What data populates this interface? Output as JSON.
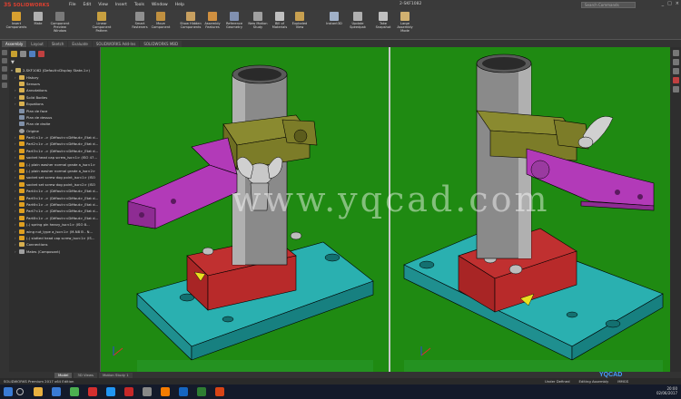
{
  "app": {
    "brand": "SOLIDWORKS",
    "document_title": "2-SKF1082",
    "search_placeholder": "Search Commands",
    "menu": [
      "File",
      "Edit",
      "View",
      "Insert",
      "Tools",
      "Window",
      "Help"
    ],
    "window_controls": [
      "_",
      "□",
      "×"
    ]
  },
  "ribbon": {
    "commands": [
      {
        "label": "Insert Components",
        "icon": "insert-components-icon",
        "color": "#d8a030"
      },
      {
        "label": "Mate",
        "icon": "mate-icon",
        "color": "#b0b0b0"
      },
      {
        "label": "Component Preview Window",
        "icon": "preview-icon",
        "color": "#7a7a7a"
      },
      {
        "label": "Linear Component Pattern",
        "icon": "pattern-icon",
        "color": "#c8a040"
      },
      {
        "label": "Smart Fasteners",
        "icon": "fastener-icon",
        "color": "#909090"
      },
      {
        "label": "Move Component",
        "icon": "move-icon",
        "color": "#c09040"
      },
      {
        "label": "Show Hidden Components",
        "icon": "show-hidden-icon",
        "color": "#c8a060"
      },
      {
        "label": "Assembly Features",
        "icon": "assembly-features-icon",
        "color": "#d09040"
      },
      {
        "label": "Reference Geometry",
        "icon": "reference-geometry-icon",
        "color": "#8090b0"
      },
      {
        "label": "New Motion Study",
        "icon": "motion-study-icon",
        "color": "#a0a0a0"
      },
      {
        "label": "Bill of Materials",
        "icon": "bom-icon",
        "color": "#c0c0c0"
      },
      {
        "label": "Exploded View",
        "icon": "exploded-view-icon",
        "color": "#c8a050"
      },
      {
        "label": "Instant3D",
        "icon": "instant3d-icon",
        "color": "#a0b0c8"
      },
      {
        "label": "Update Speedpak",
        "icon": "speedpak-icon",
        "color": "#b0b0b0"
      },
      {
        "label": "Take Snapshot",
        "icon": "snapshot-icon",
        "color": "#c0c0c0"
      },
      {
        "label": "Large Assembly Mode",
        "icon": "large-assembly-icon",
        "color": "#d0b070"
      }
    ]
  },
  "tabs": [
    "Assembly",
    "Layout",
    "Sketch",
    "Evaluate",
    "SOLIDWORKS Add-Ins",
    "SOLIDWORKS MBD"
  ],
  "feature_tree": {
    "rows": [
      {
        "label": "2-SKF1082 (Default<Display State-1>)",
        "icon": "asm",
        "arrow": "▾"
      },
      {
        "label": "History",
        "icon": "folder",
        "arrow": "›"
      },
      {
        "label": "Sensors",
        "icon": "folder",
        "arrow": ""
      },
      {
        "label": "Annotations",
        "icon": "folder",
        "arrow": "›"
      },
      {
        "label": "Solid Bodies",
        "icon": "folder",
        "arrow": "›"
      },
      {
        "label": "Equations",
        "icon": "folder",
        "arrow": "›"
      },
      {
        "label": "Plan de face",
        "icon": "plane",
        "arrow": ""
      },
      {
        "label": "Plan de dessus",
        "icon": "plane",
        "arrow": ""
      },
      {
        "label": "Plan de droite",
        "icon": "plane",
        "arrow": ""
      },
      {
        "label": "Origine",
        "icon": "origin",
        "arrow": ""
      },
      {
        "label": "Part1<1> -> (Défaut<<Défaut>_Etat d...",
        "icon": "part",
        "arrow": "›"
      },
      {
        "label": "Part2<1> -> (Défaut<<Défaut>_Etat d...",
        "icon": "part",
        "arrow": "›"
      },
      {
        "label": "Part3<1> -> (Défaut<<Défaut>_Etat d...",
        "icon": "part",
        "arrow": "›"
      },
      {
        "label": "socket head cap screw_iso<1> (ISO 47...",
        "icon": "part",
        "arrow": "›"
      },
      {
        "label": "(-) plain washer normal grade a_iso<1>",
        "icon": "part",
        "arrow": "›"
      },
      {
        "label": "(-) plain washer normal grade a_iso<2>",
        "icon": "part",
        "arrow": "›"
      },
      {
        "label": "socket set screw dog point_iso<1> (ISO",
        "icon": "part",
        "arrow": "›"
      },
      {
        "label": "socket set screw dog point_iso<2> (ISO",
        "icon": "part",
        "arrow": "›"
      },
      {
        "label": "Part4<1> -> (Défaut<<Défaut>_Etat d...",
        "icon": "part",
        "arrow": "›"
      },
      {
        "label": "Part5<1> -> (Défaut<<Défaut>_Etat d...",
        "icon": "part",
        "arrow": "›"
      },
      {
        "label": "Part6<1> -> (Défaut<<Défaut>_Etat d...",
        "icon": "part",
        "arrow": "›"
      },
      {
        "label": "Part7<1> -> (Défaut<<Défaut>_Etat d...",
        "icon": "part",
        "arrow": "›"
      },
      {
        "label": "Part8<1> -> (Défaut<<Défaut>_Etat d...",
        "icon": "part",
        "arrow": "›"
      },
      {
        "label": "(-) spring pin heavy_iso<1> (ISO 8...",
        "icon": "part",
        "arrow": "›"
      },
      {
        "label": "wing nut_type a_iso<1> (M-N8 B - N...",
        "icon": "part",
        "arrow": "›"
      },
      {
        "label": "(-) slotted head cap screw_iso<1> (IS...",
        "icon": "part",
        "arrow": "›"
      },
      {
        "label": "Connections",
        "icon": "folder",
        "arrow": "›"
      },
      {
        "label": "Mates (Composant)",
        "icon": "mate",
        "arrow": "›"
      }
    ]
  },
  "viewport": {
    "background": "#1f8a12",
    "watermark": "www.yqcad.com"
  },
  "bottom_tabs": [
    "Model",
    "3D Views",
    "Motion Study 1"
  ],
  "status": {
    "left": "SOLIDWORKS Premium 2017 x64 Edition",
    "state": "Under Defined",
    "mode": "Editing Assembly",
    "units": "MMGS"
  },
  "taskbar": {
    "apps": [
      {
        "icon": "folder-icon",
        "color": "#e8b040"
      },
      {
        "icon": "browser-icon",
        "color": "#3a7bd5"
      },
      {
        "icon": "chrome-icon",
        "color": "#4caf50"
      },
      {
        "icon": "opera-icon",
        "color": "#d32f2f"
      },
      {
        "icon": "windows-icon",
        "color": "#2196f3"
      },
      {
        "icon": "solidworks-icon",
        "color": "#c62828"
      },
      {
        "icon": "app-icon",
        "color": "#888888"
      },
      {
        "icon": "vlc-icon",
        "color": "#f57c00"
      },
      {
        "icon": "word-icon",
        "color": "#1565c0"
      },
      {
        "icon": "excel-icon",
        "color": "#2e7d32"
      },
      {
        "icon": "powerpoint-icon",
        "color": "#d84315"
      }
    ],
    "time": "20:00",
    "date": "02/06/2017"
  },
  "brand_watermark": "YQCAD"
}
